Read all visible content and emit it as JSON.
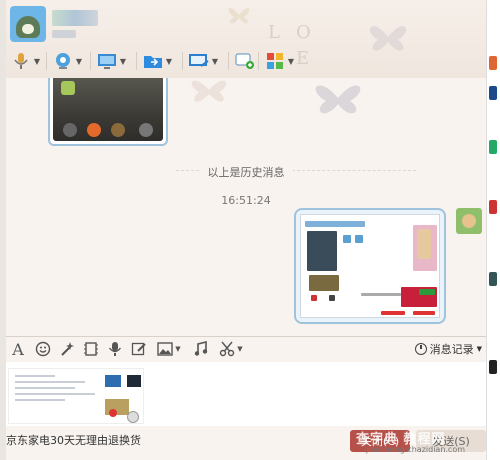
{
  "header": {
    "toolbar": [
      {
        "name": "voice-call-button",
        "icon": "microphone-icon"
      },
      {
        "name": "video-call-button",
        "icon": "webcam-icon"
      },
      {
        "name": "remote-desktop-button",
        "icon": "monitor-icon"
      },
      {
        "name": "send-file-button",
        "icon": "folder-arrow-icon"
      },
      {
        "name": "share-screen-button",
        "icon": "screen-share-icon"
      },
      {
        "name": "create-discussion-button",
        "icon": "chat-add-icon"
      },
      {
        "name": "apps-button",
        "icon": "apps-grid-icon"
      }
    ]
  },
  "messages": {
    "history_label": "以上是历史消息",
    "timestamp": "16:51:24"
  },
  "input_toolbar": {
    "history_button_label": "消息记录"
  },
  "bottom": {
    "ad_text": "京东家电30天无理由退换货",
    "close_label": "关闭(C)",
    "send_label": "发送(S)",
    "watermark": "查字典 教程网",
    "watermark_url": "jiaocheng.chazidian.com"
  },
  "colors": {
    "window_bg": "#f8f3ef",
    "bubble_border": "#9fc3dd",
    "close_button": "#b6514a"
  }
}
